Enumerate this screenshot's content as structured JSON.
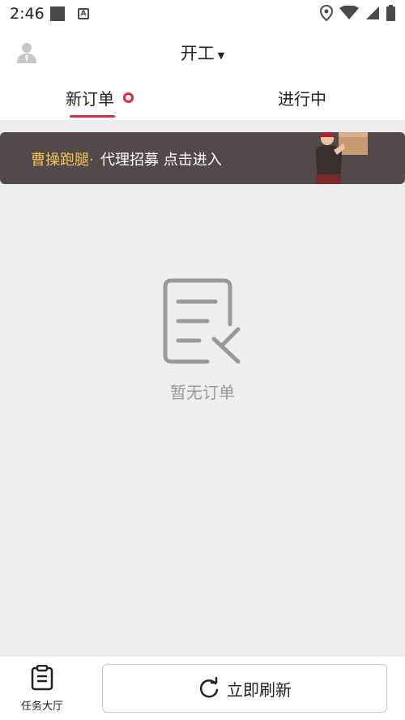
{
  "statusbar": {
    "time": "2:46"
  },
  "header": {
    "title": "开工"
  },
  "tabs": [
    {
      "label": "新订单"
    },
    {
      "label": "进行中"
    }
  ],
  "banner": {
    "brand": "曹操跑腿·",
    "text": "代理招募 点击进入"
  },
  "empty_state": {
    "text": "暂无订单"
  },
  "bottom_nav": {
    "task_hall_label": "任务大厅"
  },
  "actions": {
    "refresh_label": "立即刷新"
  },
  "colors": {
    "accent": "#e0283e",
    "banner_bg": "#54494a",
    "brand_yellow": "#f2c35b"
  }
}
